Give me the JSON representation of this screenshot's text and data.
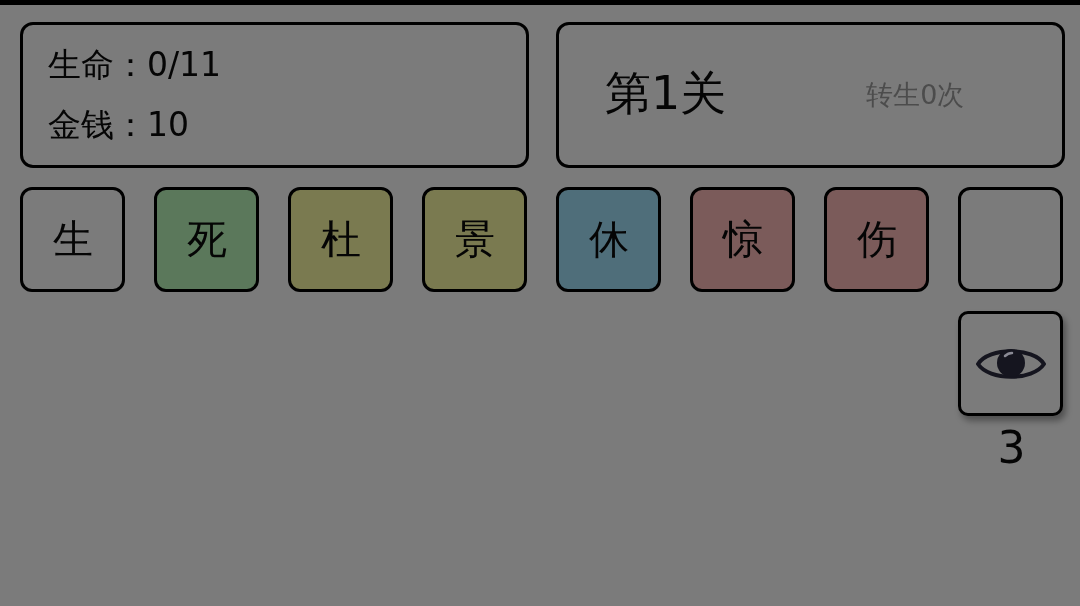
{
  "stats_panel": {
    "lines": [
      "生命：0/11",
      "金钱：10"
    ]
  },
  "level_panel": {
    "title": "第1关",
    "rebirth": "转生0次"
  },
  "tiles": [
    {
      "kind": "glyph",
      "label": "生"
    },
    {
      "kind": "glyph",
      "label": "死",
      "color": "#5b785b"
    },
    {
      "kind": "glyph",
      "label": "杜",
      "color": "#7a7a50"
    },
    {
      "kind": "glyph",
      "label": "景",
      "color": "#7a7a50"
    },
    {
      "kind": "glyph",
      "label": "休",
      "color": "#4f6e7a"
    },
    {
      "kind": "glyph",
      "label": "惊",
      "color": "#7b5b5a"
    },
    {
      "kind": "glyph",
      "label": "伤",
      "color": "#7b5b5a"
    },
    {
      "kind": "empty"
    }
  ],
  "eye_button": {
    "count": "3"
  }
}
